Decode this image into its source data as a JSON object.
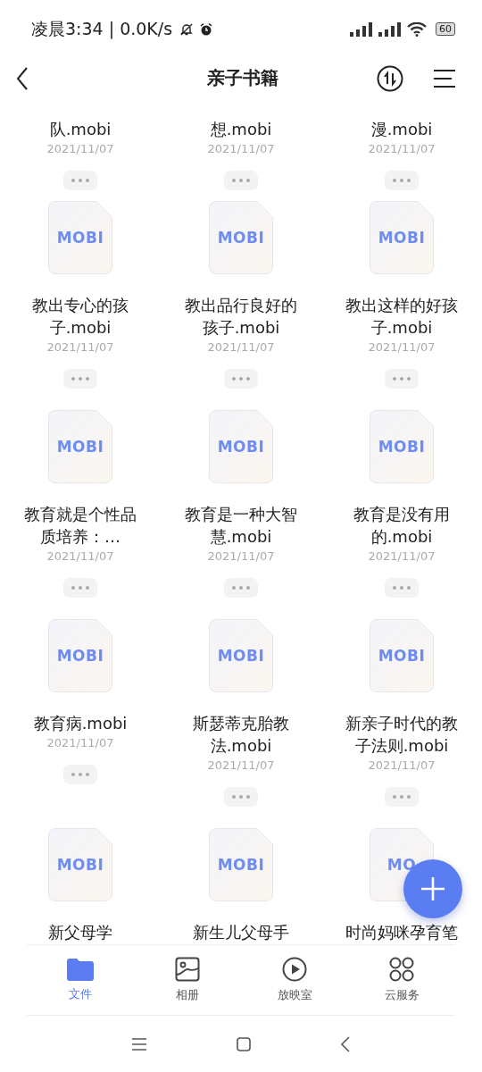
{
  "status_bar": {
    "time_speed": "凌晨3:34 | 0.0K/s",
    "battery": "60"
  },
  "header": {
    "title": "亲子书籍"
  },
  "files": [
    {
      "kind": "clipped",
      "name": "队.mobi",
      "date": "2021/11/07"
    },
    {
      "kind": "clipped",
      "name": "想.mobi",
      "date": "2021/11/07"
    },
    {
      "kind": "clipped",
      "name": "漫.mobi",
      "date": "2021/11/07"
    },
    {
      "kind": "file",
      "badge": "MOBI",
      "name": "教出专心的孩子.mobi",
      "date": "2021/11/07"
    },
    {
      "kind": "file",
      "badge": "MOBI",
      "name": "教出品行良好的孩子.mobi",
      "date": "2021/11/07"
    },
    {
      "kind": "file",
      "badge": "MOBI",
      "name": "教出这样的好孩子.mobi",
      "date": "2021/11/07"
    },
    {
      "kind": "file",
      "badge": "MOBI",
      "name": "教育就是个性品质培养：…",
      "date": "2021/11/07"
    },
    {
      "kind": "file",
      "badge": "MOBI",
      "name": "教育是一种大智慧.mobi",
      "date": "2021/11/07"
    },
    {
      "kind": "file",
      "badge": "MOBI",
      "name": "教育是没有用的.mobi",
      "date": "2021/11/07"
    },
    {
      "kind": "file",
      "badge": "MOBI",
      "name": "教育病.mobi",
      "date": "2021/11/07"
    },
    {
      "kind": "file",
      "badge": "MOBI",
      "name": "斯瑟蒂克胎教法.mobi",
      "date": "2021/11/07"
    },
    {
      "kind": "file",
      "badge": "MOBI",
      "name": "新亲子时代的教子法则.mobi",
      "date": "2021/11/07"
    },
    {
      "kind": "cut",
      "badge": "MOBI",
      "name": "新父母学"
    },
    {
      "kind": "cut",
      "badge": "MOBI",
      "name": "新生儿父母手"
    },
    {
      "kind": "cut",
      "badge": "MO",
      "name": "时尚妈咪孕育笔"
    }
  ],
  "bottom_nav": [
    {
      "kind": "folder",
      "label": "文件",
      "selected": true
    },
    {
      "kind": "album",
      "label": "相册",
      "selected": false
    },
    {
      "kind": "player",
      "label": "放映室",
      "selected": false
    },
    {
      "kind": "apps",
      "label": "云服务",
      "selected": false
    }
  ]
}
